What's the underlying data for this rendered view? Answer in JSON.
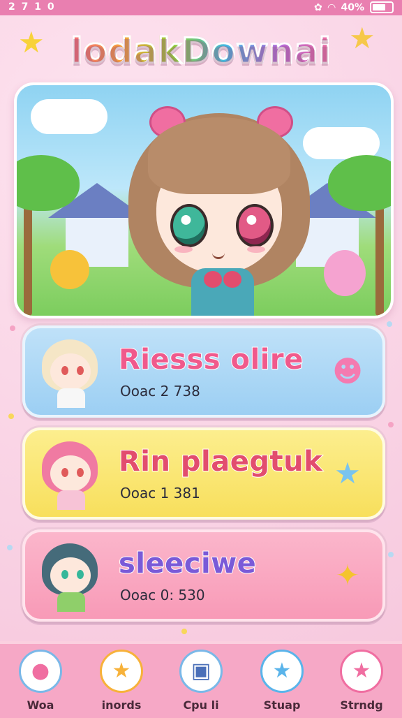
{
  "status_bar": {
    "time": "2 7 1 0",
    "battery": "40%"
  },
  "app": {
    "title": "lodakDownai"
  },
  "cards": [
    {
      "title": "Riesss olire",
      "subtitle": "Ooac 2 738",
      "title_color": "#f05a8c",
      "avatar_hair": "#f5e6c6",
      "avatar_eye": "#e05a5a",
      "avatar_body": "#f7f7f7",
      "icon": "cat-face-icon"
    },
    {
      "title": "Rin plaegtuk",
      "subtitle": "Ooac 1 381",
      "title_color": "#e24d6e",
      "avatar_hair": "#f07aa2",
      "avatar_eye": "#e05a5a",
      "avatar_body": "#f7c3d6",
      "icon": "star-face-icon"
    },
    {
      "title": "sleeciwe",
      "subtitle": "Ooac 0: 530",
      "title_color": "#7a5ad8",
      "avatar_hair": "#456b7a",
      "avatar_eye": "#35b79a",
      "avatar_body": "#8fcf6a",
      "icon": "magic-wand-icon"
    }
  ],
  "nav": [
    {
      "label": "Woa",
      "icon": "pig-icon"
    },
    {
      "label": "inords",
      "icon": "star-character-icon"
    },
    {
      "label": "Cpu li",
      "icon": "book-icon"
    },
    {
      "label": "Stuap",
      "icon": "blue-star-icon"
    },
    {
      "label": "Strndg",
      "icon": "pink-star-icon"
    }
  ],
  "colors": {
    "status_bar": "#e97fb0",
    "background": "#f9d2e4",
    "nav_background": "#f6a8c6"
  }
}
